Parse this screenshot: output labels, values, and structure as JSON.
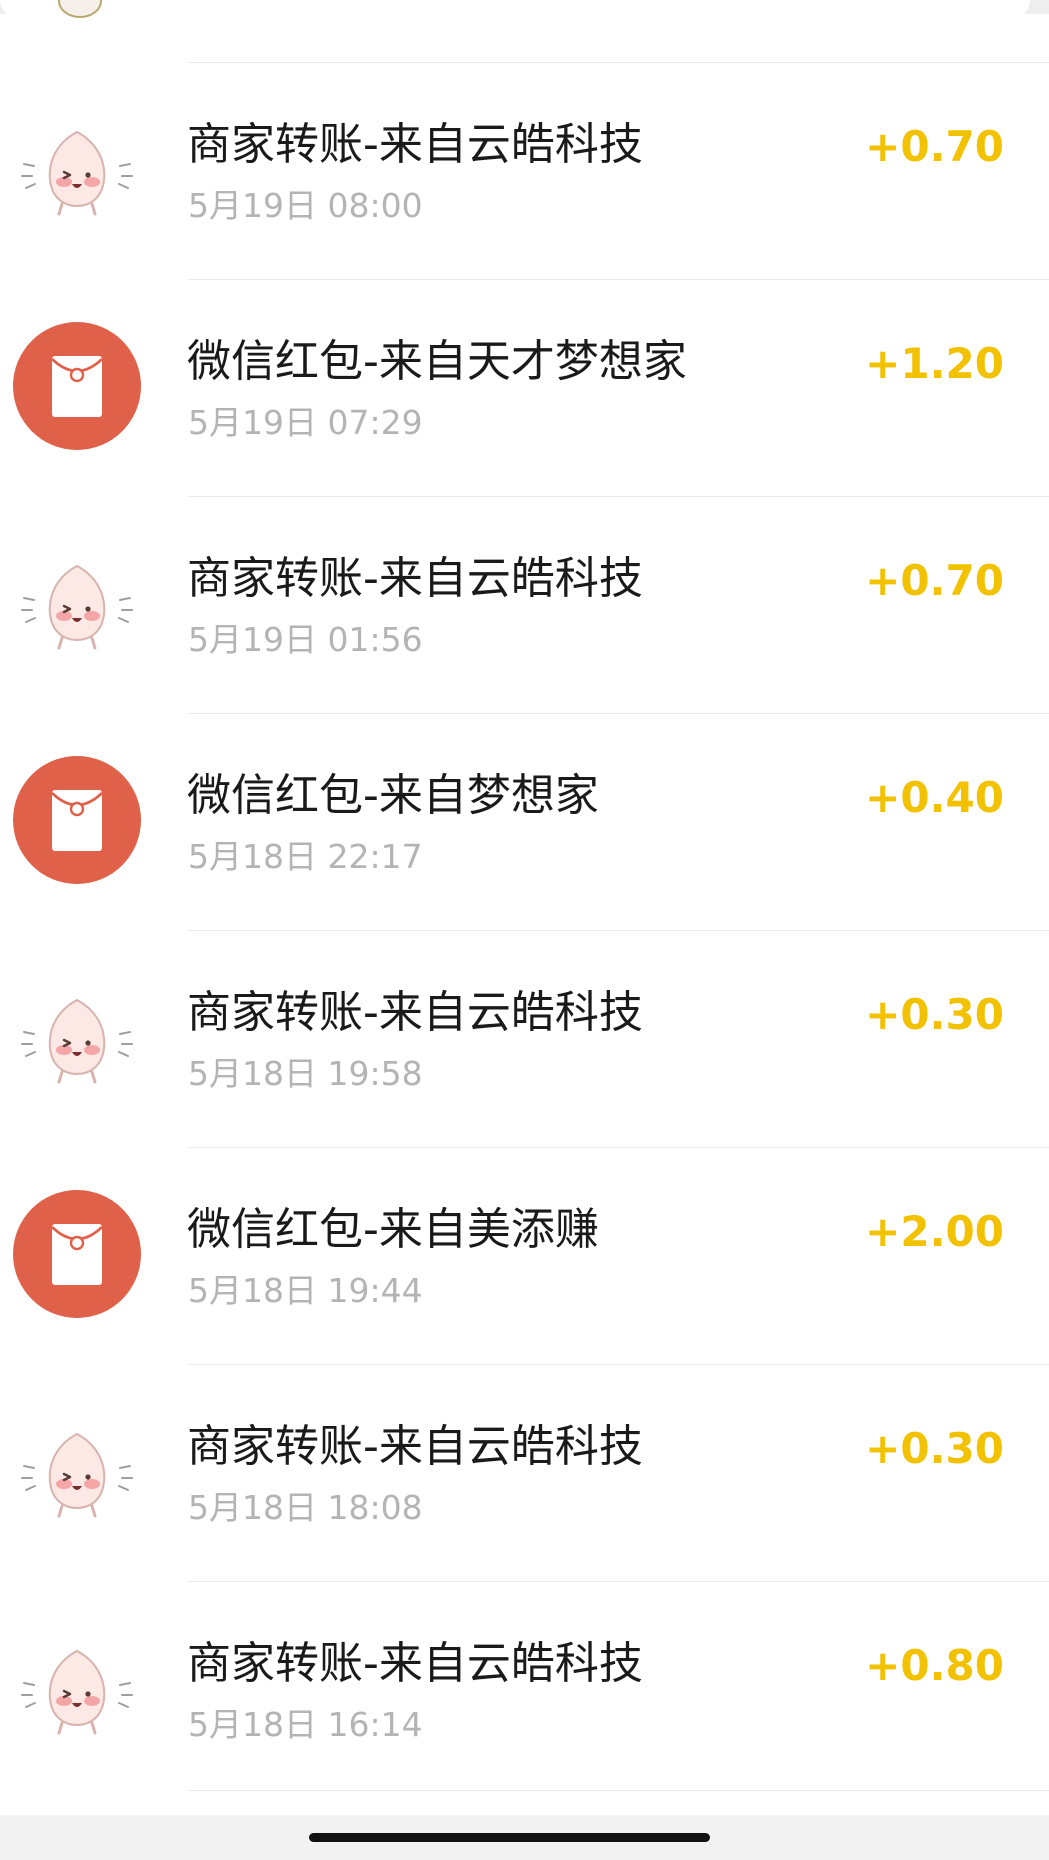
{
  "transactions": [
    {
      "type": "merchant",
      "icon": "peach-character-icon",
      "title": "商家转账-来自云皓科技",
      "time": "5月19日 08:00",
      "amount": "+0.70"
    },
    {
      "type": "redpacket",
      "icon": "red-envelope-icon",
      "title": "微信红包-来自天才梦想家",
      "time": "5月19日 07:29",
      "amount": "+1.20"
    },
    {
      "type": "merchant",
      "icon": "peach-character-icon",
      "title": "商家转账-来自云皓科技",
      "time": "5月19日 01:56",
      "amount": "+0.70"
    },
    {
      "type": "redpacket",
      "icon": "red-envelope-icon",
      "title": "微信红包-来自梦想家",
      "time": "5月18日 22:17",
      "amount": "+0.40"
    },
    {
      "type": "merchant",
      "icon": "peach-character-icon",
      "title": "商家转账-来自云皓科技",
      "time": "5月18日 19:58",
      "amount": "+0.30"
    },
    {
      "type": "redpacket",
      "icon": "red-envelope-icon",
      "title": "微信红包-来自美添赚",
      "time": "5月18日 19:44",
      "amount": "+2.00"
    },
    {
      "type": "merchant",
      "icon": "peach-character-icon",
      "title": "商家转账-来自云皓科技",
      "time": "5月18日 18:08",
      "amount": "+0.30"
    },
    {
      "type": "merchant",
      "icon": "peach-character-icon",
      "title": "商家转账-来自云皓科技",
      "time": "5月18日 16:14",
      "amount": "+0.80"
    }
  ],
  "colors": {
    "amount": "#f2c100",
    "red_packet": "#e06149",
    "title": "#1a1a1a",
    "time": "#b4b4b4"
  }
}
